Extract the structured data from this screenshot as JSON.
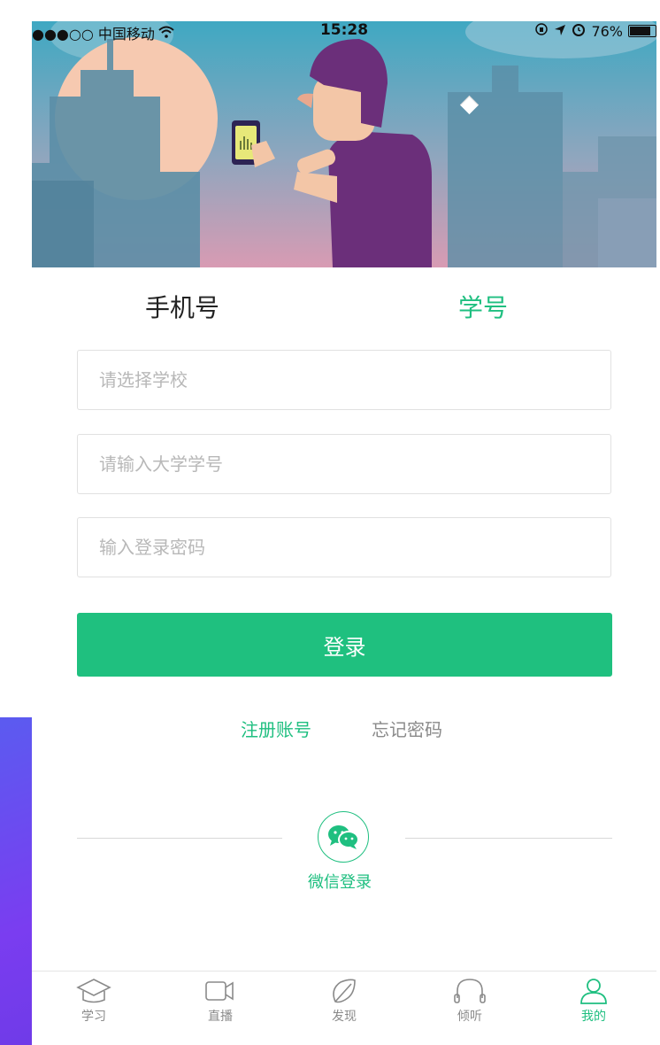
{
  "status_bar": {
    "carrier": "●●●○○ 中国移动",
    "time": "15:28",
    "battery": "76%"
  },
  "tabs": {
    "phone": "手机号",
    "student_id": "学号",
    "active": "student_id"
  },
  "form": {
    "school_placeholder": "请选择学校",
    "student_id_placeholder": "请输入大学学号",
    "password_placeholder": "输入登录密码",
    "login_button": "登录"
  },
  "links": {
    "register": "注册账号",
    "forgot_password": "忘记密码"
  },
  "wechat": {
    "label": "微信登录",
    "icon": "wechat-icon"
  },
  "bottom_nav": [
    {
      "label": "学习",
      "icon": "graduation-cap-icon"
    },
    {
      "label": "直播",
      "icon": "video-camera-icon"
    },
    {
      "label": "发现",
      "icon": "leaf-icon"
    },
    {
      "label": "倾听",
      "icon": "headphones-icon"
    },
    {
      "label": "我的",
      "icon": "person-icon",
      "active": true
    }
  ],
  "colors": {
    "accent": "#1fc07f",
    "placeholder": "#b8b8b8",
    "inactive": "#8a8a8a"
  }
}
